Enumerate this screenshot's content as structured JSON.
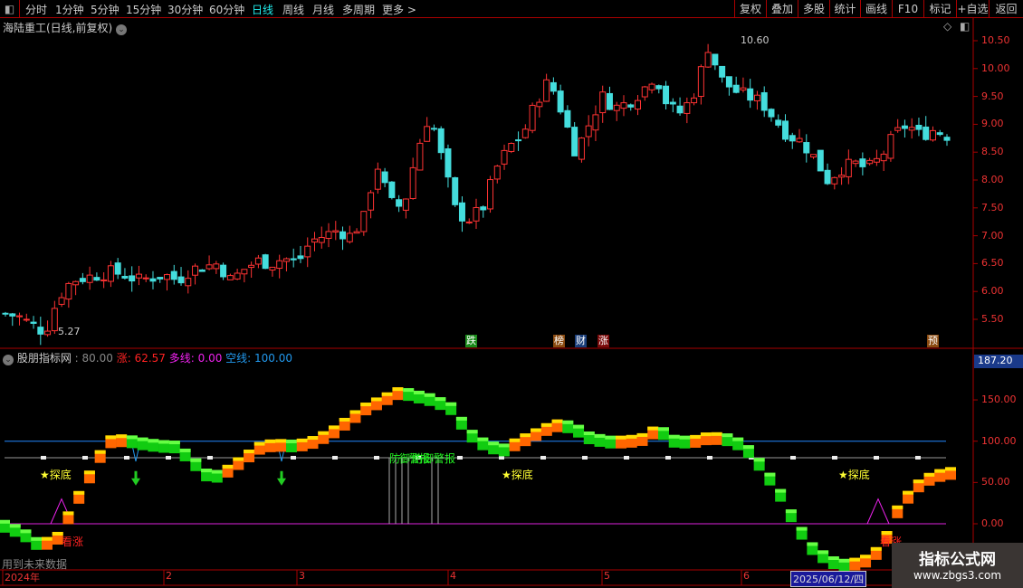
{
  "toolbar": {
    "periods": [
      "分时",
      "1分钟",
      "5分钟",
      "15分钟",
      "30分钟",
      "60分钟",
      "日线",
      "周线",
      "月线",
      "多周期",
      "更多 >"
    ],
    "active_period": "日线",
    "buttons": [
      "复权",
      "叠加",
      "多股",
      "统计",
      "画线",
      "F10",
      "标记",
      "+自选",
      "返回"
    ]
  },
  "main_chart": {
    "title": "海陆重工(日线,前复权)",
    "high_label": "10.60",
    "low_label": "5.27",
    "price_ticks": [
      "10.50",
      "10.00",
      "9.50",
      "9.00",
      "8.50",
      "8.00",
      "7.50",
      "7.00",
      "6.50",
      "6.00",
      "5.50"
    ],
    "price_keypoints": [
      5.6,
      5.55,
      5.4,
      5.27,
      5.9,
      6.2,
      6.25,
      6.3,
      6.35,
      6.3,
      6.2,
      6.25,
      6.3,
      6.2,
      6.4,
      6.45,
      6.5,
      6.2,
      6.4,
      6.55,
      6.5,
      6.6,
      6.5,
      6.9,
      7.0,
      7.1,
      7.0,
      7.3,
      8.3,
      7.6,
      7.5,
      8.5,
      9.2,
      8.3,
      7.4,
      7.3,
      7.5,
      8.2,
      8.6,
      8.8,
      9.4,
      9.8,
      9.2,
      8.5,
      9.0,
      9.5,
      9.3,
      9.4,
      9.6,
      9.9,
      9.3,
      9.2,
      9.6,
      10.4,
      9.8,
      9.6,
      9.5,
      9.4,
      9.1,
      8.8,
      8.7,
      8.4,
      8.0,
      8.2,
      8.3,
      8.2,
      8.4,
      8.8,
      9.0,
      8.8,
      8.9,
      8.8
    ],
    "markers": [
      {
        "text": "跌",
        "color": "#1a8a1a"
      },
      {
        "text": "榜",
        "color": "#8a4a10"
      },
      {
        "text": "财",
        "color": "#1a3e7a"
      },
      {
        "text": "涨",
        "color": "#7a0a0a"
      },
      {
        "text": "预",
        "color": "#8a4a10"
      }
    ]
  },
  "indicator": {
    "name": "股朋指标网",
    "value_label": ": 80.00",
    "zhang_label": "涨: 62.57",
    "duoxian_label": "多线: 0.00",
    "kongxian_label": "空线: 100.00",
    "current_value": "187.20",
    "ticks": [
      "150.00",
      "100.00",
      "50.00",
      "0.00"
    ],
    "series_keypoints": [
      -2,
      -10,
      -25,
      -20,
      20,
      60,
      100,
      102,
      98,
      95,
      94,
      75,
      55,
      65,
      80,
      95,
      96,
      95,
      100,
      110,
      125,
      140,
      150,
      160,
      155,
      150,
      140,
      110,
      95,
      90,
      100,
      110,
      120,
      118,
      105,
      100,
      100,
      102,
      115,
      100,
      100,
      105,
      103,
      95,
      70,
      40,
      0,
      -30,
      -45,
      -50,
      -45,
      -30,
      20,
      45,
      58,
      62
    ],
    "labels": {
      "tandi": "★探底",
      "kanzhang": "看涨",
      "warning": "防御警报",
      "note": "用到未来数据"
    }
  },
  "time_axis": {
    "labels": [
      "2024年",
      "2",
      "3",
      "4",
      "5",
      "6"
    ],
    "cursor_date": "2025/06/12/四"
  },
  "watermark": {
    "title": "指标公式网",
    "url": "www.zbgs3.com"
  }
}
